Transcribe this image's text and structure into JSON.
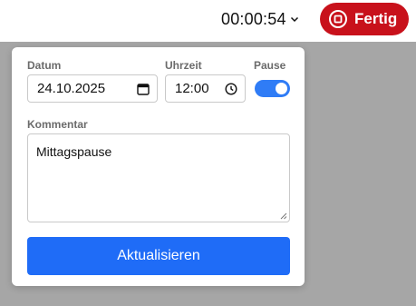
{
  "header": {
    "timer": "00:00:54",
    "finish_button_label": "Fertig"
  },
  "form": {
    "date": {
      "label": "Datum",
      "value": "24.10.2025",
      "icon": "calendar-icon"
    },
    "time": {
      "label": "Uhrzeit",
      "value": "12:00",
      "icon": "clock-icon"
    },
    "pause": {
      "label": "Pause",
      "enabled": true
    },
    "comment": {
      "label": "Kommentar",
      "value": "Mittagspause"
    },
    "submit_label": "Aktualisieren"
  },
  "colors": {
    "accent_blue": "#1f6cf7",
    "toggle_blue": "#2f7cf6",
    "finish_red": "#c8111b",
    "overlay_gray": "#a6a6a6"
  }
}
